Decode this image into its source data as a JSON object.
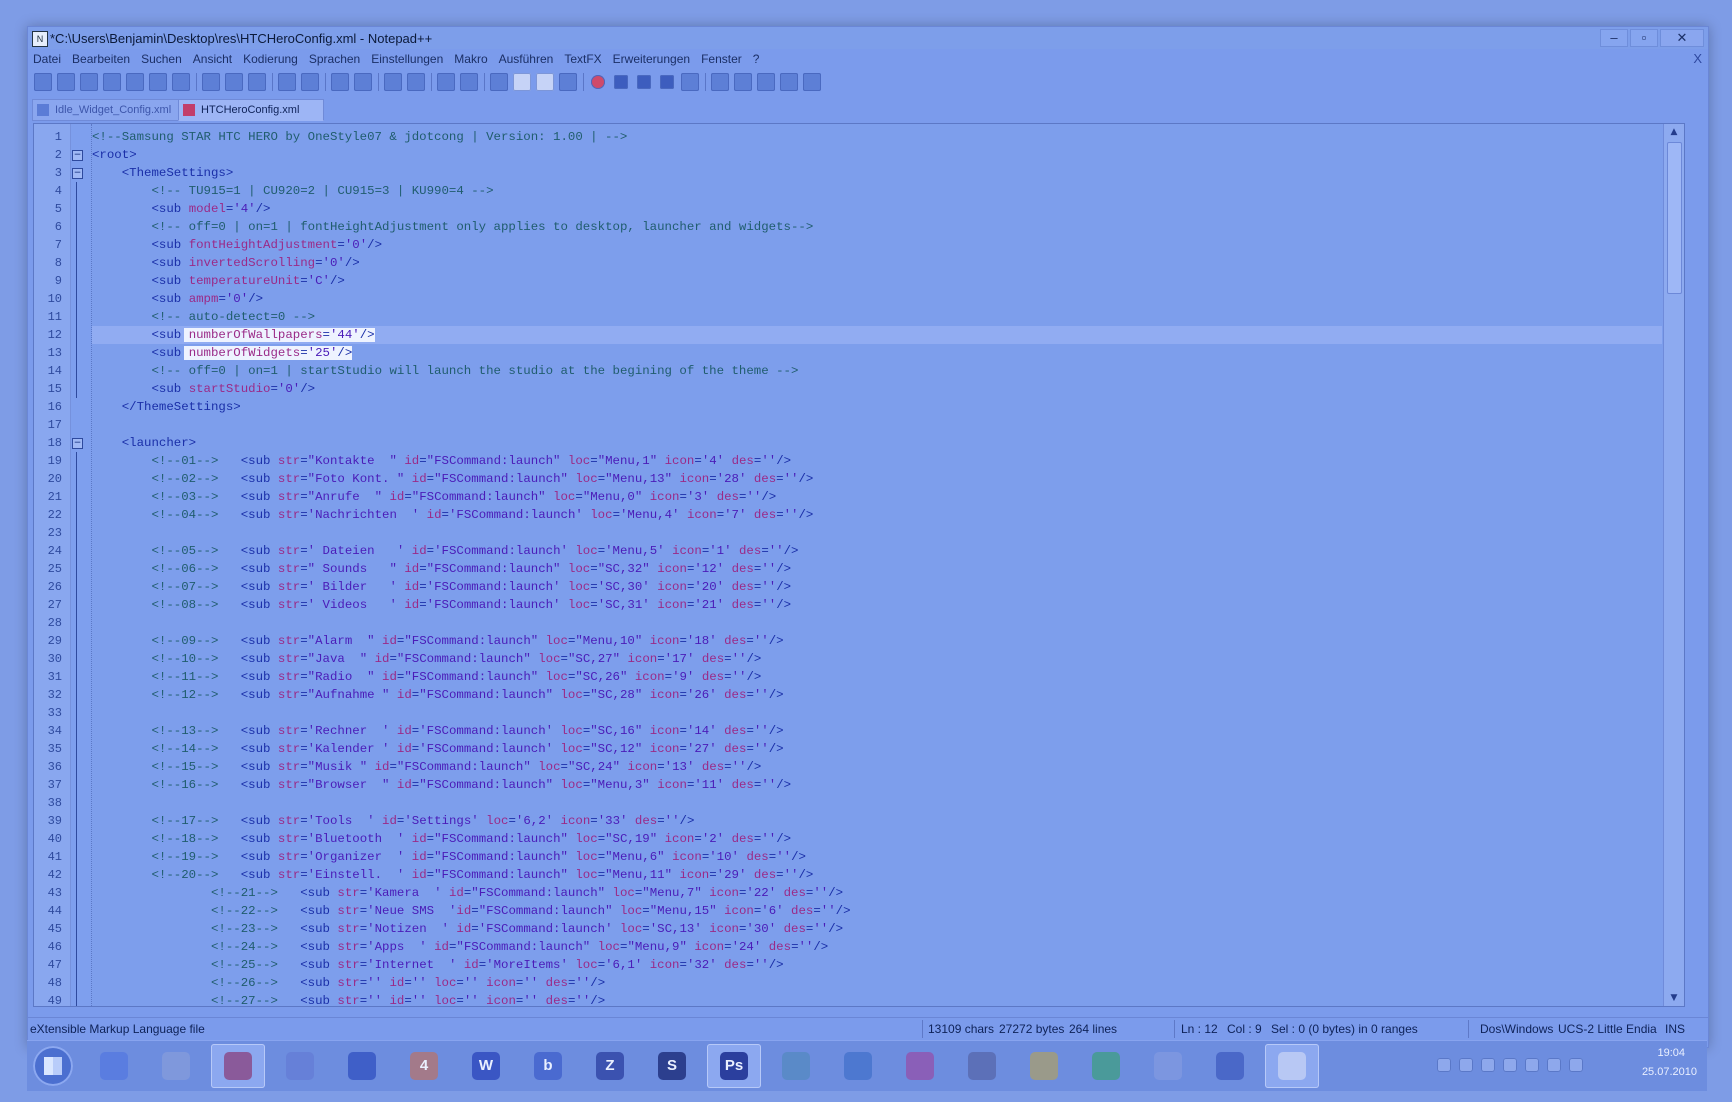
{
  "window": {
    "title": "*C:\\Users\\Benjamin\\Desktop\\res\\HTCHeroConfig.xml - Notepad++",
    "buttons": {
      "minimize": "–",
      "maximize": "▫",
      "close": "✕"
    }
  },
  "menubar": {
    "items": [
      "Datei",
      "Bearbeiten",
      "Suchen",
      "Ansicht",
      "Kodierung",
      "Sprachen",
      "Einstellungen",
      "Makro",
      "Ausführen",
      "TextFX",
      "Erweiterungen",
      "Fenster",
      "?"
    ],
    "close": "X"
  },
  "tabs": [
    {
      "label": "Idle_Widget_Config.xml",
      "active": false
    },
    {
      "label": "HTCHeroConfig.xml",
      "active": true
    }
  ],
  "editor": {
    "current_line": 12,
    "fold_markers": [
      2,
      3,
      16,
      18
    ],
    "lines": [
      "<!--Samsung STAR HTC HERO by OneStyle07 & jdotcong | Version: 1.00 | -->",
      "<root>",
      "    <ThemeSettings>",
      "        <!-- TU915=1 | CU920=2 | CU915=3 | KU990=4 -->",
      "        <sub model='4'/>",
      "        <!-- off=0 | on=1 | fontHeightAdjustment only applies to desktop, launcher and widgets-->",
      "        <sub fontHeightAdjustment='0'/>",
      "        <sub invertedScrolling='0'/>",
      "        <sub temperatureUnit='C'/>",
      "        <sub ampm='0'/>",
      "        <!-- auto-detect=0 -->",
      "        <sub numberOfWallpapers='44'/>",
      "        <sub numberOfWidgets='25'/>",
      "        <!-- off=0 | on=1 | startStudio will launch the studio at the begining of the theme -->",
      "        <sub startStudio='0'/>",
      "    </ThemeSettings>",
      "",
      "    <launcher>",
      "        <!--01-->   <sub str=\"Kontakte  \" id=\"FSCommand:launch\" loc=\"Menu,1\" icon='4' des=''/>",
      "        <!--02-->   <sub str=\"Foto Kont. \" id=\"FSCommand:launch\" loc=\"Menu,13\" icon='28' des=''/>",
      "        <!--03-->   <sub str=\"Anrufe  \" id=\"FSCommand:launch\" loc=\"Menu,0\" icon='3' des=''/>",
      "        <!--04-->   <sub str='Nachrichten  ' id='FSCommand:launch' loc='Menu,4' icon='7' des=''/>",
      "",
      "        <!--05-->   <sub str=' Dateien   ' id='FSCommand:launch' loc='Menu,5' icon='1' des=''/>",
      "        <!--06-->   <sub str=\" Sounds   \" id=\"FSCommand:launch\" loc=\"SC,32\" icon='12' des=''/>",
      "        <!--07-->   <sub str=' Bilder   ' id='FSCommand:launch' loc='SC,30' icon='20' des=''/>",
      "        <!--08-->   <sub str=' Videos   ' id='FSCommand:launch' loc='SC,31' icon='21' des=''/>",
      "",
      "        <!--09-->   <sub str=\"Alarm  \" id=\"FSCommand:launch\" loc=\"Menu,10\" icon='18' des=''/>",
      "        <!--10-->   <sub str=\"Java  \" id=\"FSCommand:launch\" loc=\"SC,27\" icon='17' des=''/>",
      "        <!--11-->   <sub str=\"Radio  \" id=\"FSCommand:launch\" loc=\"SC,26\" icon='9' des=''/>",
      "        <!--12-->   <sub str=\"Aufnahme \" id=\"FSCommand:launch\" loc=\"SC,28\" icon='26' des=''/>",
      "",
      "        <!--13-->   <sub str='Rechner  ' id='FSCommand:launch' loc=\"SC,16\" icon='14' des=''/>",
      "        <!--14-->   <sub str='Kalender ' id='FSCommand:launch' loc=\"SC,12\" icon='27' des=''/>",
      "        <!--15-->   <sub str=\"Musik \" id=\"FSCommand:launch\" loc=\"SC,24\" icon='13' des=''/>",
      "        <!--16-->   <sub str=\"Browser  \" id=\"FSCommand:launch\" loc=\"Menu,3\" icon='11' des=''/>",
      "",
      "        <!--17-->   <sub str='Tools  ' id='Settings' loc='6,2' icon='33' des=''/>",
      "        <!--18-->   <sub str='Bluetooth  ' id=\"FSCommand:launch\" loc=\"SC,19\" icon='2' des=''/>",
      "        <!--19-->   <sub str='Organizer  ' id=\"FSCommand:launch\" loc=\"Menu,6\" icon='10' des=''/>",
      "        <!--20-->   <sub str='Einstell.  ' id=\"FSCommand:launch\" loc=\"Menu,11\" icon='29' des=''/>",
      "                <!--21-->   <sub str='Kamera  ' id=\"FSCommand:launch\" loc=\"Menu,7\" icon='22' des=''/>",
      "                <!--22-->   <sub str='Neue SMS  'id=\"FSCommand:launch\" loc=\"Menu,15\" icon='6' des=''/>",
      "                <!--23-->   <sub str='Notizen  ' id='FSCommand:launch' loc='SC,13' icon='30' des=''/>",
      "                <!--24-->   <sub str='Apps  ' id=\"FSCommand:launch\" loc=\"Menu,9\" icon='24' des=''/>",
      "                <!--25-->   <sub str='Internet  ' id='MoreItems' loc='6,1' icon='32' des=''/>",
      "                <!--26-->   <sub str='' id='' loc='' icon='' des=''/>",
      "                <!--27-->   <sub str='' id='' loc='' icon='' des=''/>"
    ]
  },
  "statusbar": {
    "filetype": "eXtensible Markup Language file",
    "chars": "13109 chars",
    "bytes": "27272 bytes",
    "lines": "264 lines",
    "ln": "Ln : 12",
    "col": "Col : 9",
    "sel": "Sel : 0 (0 bytes) in 0 ranges",
    "eol": "Dos\\Windows",
    "encoding": "UCS-2 Little Endia",
    "mode": "INS"
  },
  "taskbar": {
    "apps": [
      {
        "name": "media-player",
        "label": "",
        "color": "#5a7de0"
      },
      {
        "name": "explorer",
        "label": "",
        "color": "#7f98dc"
      },
      {
        "name": "firefox",
        "label": "",
        "color": "#8a5a9a",
        "active": true
      },
      {
        "name": "network-app",
        "label": "",
        "color": "#6680d8"
      },
      {
        "name": "chat-app",
        "label": "",
        "color": "#3f5fc8"
      },
      {
        "name": "app-4",
        "label": "4",
        "color": "#a37a8a"
      },
      {
        "name": "word",
        "label": "W",
        "color": "#3a56c4"
      },
      {
        "name": "bing",
        "label": "b",
        "color": "#4a6ad0"
      },
      {
        "name": "zend",
        "label": "Z",
        "color": "#3b52b0"
      },
      {
        "name": "app-s",
        "label": "S",
        "color": "#2c3f8e"
      },
      {
        "name": "photoshop",
        "label": "Ps",
        "color": "#2b3f9e",
        "active": true
      },
      {
        "name": "chrome",
        "label": "",
        "color": "#5a8ac8"
      },
      {
        "name": "puzzle-app",
        "label": "",
        "color": "#4d78d0"
      },
      {
        "name": "power-app",
        "label": "",
        "color": "#8a5fb8"
      },
      {
        "name": "keyboard-app",
        "label": "",
        "color": "#5c70b8"
      },
      {
        "name": "tools-app",
        "label": "",
        "color": "#9a9a8a"
      },
      {
        "name": "flower-app",
        "label": "",
        "color": "#4a9a9a"
      },
      {
        "name": "network-monitor",
        "label": "",
        "color": "#7c96e0"
      },
      {
        "name": "factory-app",
        "label": "",
        "color": "#4a68c8"
      },
      {
        "name": "notepadpp",
        "label": "",
        "color": "#b8c8f4",
        "active": true
      }
    ],
    "clock_time": "19:04",
    "clock_date": "25.07.2010"
  }
}
